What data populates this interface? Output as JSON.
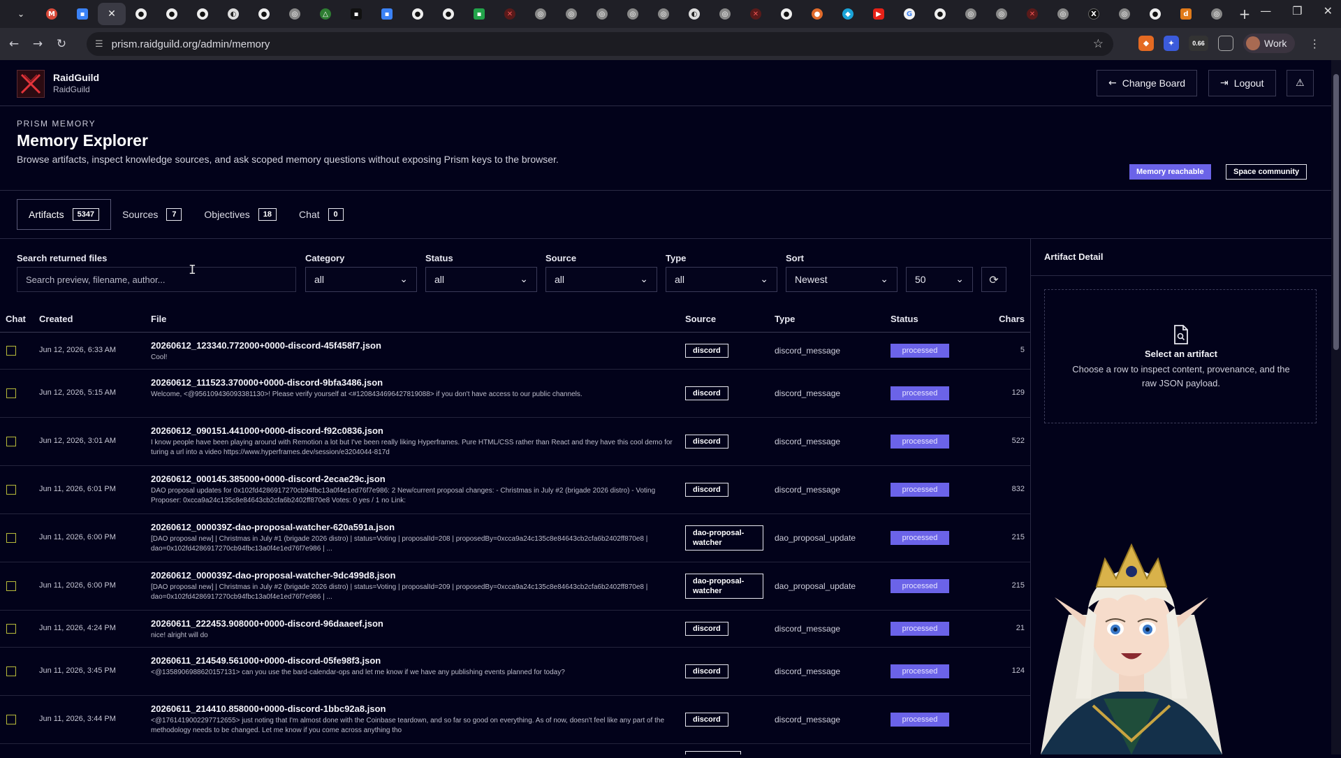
{
  "browser": {
    "url": "prism.raidguild.org/admin/memory",
    "profile_label": "Work",
    "ext_badge": "0.66"
  },
  "header": {
    "org_name": "RaidGuild",
    "org_sub": "RaidGuild",
    "change_board_label": "Change Board",
    "logout_label": "Logout"
  },
  "page": {
    "eyebrow": "PRISM MEMORY",
    "title": "Memory Explorer",
    "description": "Browse artifacts, inspect knowledge sources, and ask scoped memory questions without exposing Prism keys to the browser.",
    "badge_memory": "Memory reachable",
    "badge_space": "Space community"
  },
  "tabs": [
    {
      "label": "Artifacts",
      "count": "5347"
    },
    {
      "label": "Sources",
      "count": "7"
    },
    {
      "label": "Objectives",
      "count": "18"
    },
    {
      "label": "Chat",
      "count": "0"
    }
  ],
  "filters": {
    "search_label": "Search returned files",
    "search_placeholder": "Search preview, filename, author...",
    "category_label": "Category",
    "category_value": "all",
    "status_label": "Status",
    "status_value": "all",
    "source_label": "Source",
    "source_value": "all",
    "type_label": "Type",
    "type_value": "all",
    "sort_label": "Sort",
    "sort_value": "Newest",
    "limit_value": "50"
  },
  "table": {
    "columns": [
      "Chat",
      "Created",
      "File",
      "Source",
      "Type",
      "Status",
      "Chars"
    ],
    "rows": [
      {
        "created": "Jun 12, 2026, 6:33 AM",
        "file": "20260612_123340.772000+0000-discord-45f458f7.json",
        "preview": "Cool!",
        "source": "discord",
        "type": "discord_message",
        "status": "processed",
        "chars": "5"
      },
      {
        "created": "Jun 12, 2026, 5:15 AM",
        "file": "20260612_111523.370000+0000-discord-9bfa3486.json",
        "preview": "Welcome, <@956109436093381130>! Please verify yourself at <#1208434696427819088> if you don't have access to our public channels.",
        "source": "discord",
        "type": "discord_message",
        "status": "processed",
        "chars": "129"
      },
      {
        "created": "Jun 12, 2026, 3:01 AM",
        "file": "20260612_090151.441000+0000-discord-f92c0836.json",
        "preview": "I know people have been playing around with Remotion a lot but I've been really liking Hyperframes. Pure HTML/CSS rather than React and they have this cool demo for turing a url into a video https://www.hyperframes.dev/session/e3204044-817d",
        "source": "discord",
        "type": "discord_message",
        "status": "processed",
        "chars": "522"
      },
      {
        "created": "Jun 11, 2026, 6:01 PM",
        "file": "20260612_000145.385000+0000-discord-2ecae29c.json",
        "preview": "DAO proposal updates for 0x102fd4286917270cb94fbc13a0f4e1ed76f7e986: 2 New/current proposal changes: - Christmas in July #2 (brigade 2026 distro) - Voting Proposer: 0xcca9a24c135c8e84643cb2cfa6b2402ff870e8 Votes: 0 yes / 1 no Link:",
        "source": "discord",
        "type": "discord_message",
        "status": "processed",
        "chars": "832"
      },
      {
        "created": "Jun 11, 2026, 6:00 PM",
        "file": "20260612_000039Z-dao-proposal-watcher-620a591a.json",
        "preview": "[DAO proposal new] | Christmas in July #1 (brigade 2026 distro) | status=Voting | proposalId=208 | proposedBy=0xcca9a24c135c8e84643cb2cfa6b2402ff870e8 | dao=0x102fd4286917270cb94fbc13a0f4e1ed76f7e986 | ...",
        "source": "dao-proposal-watcher",
        "type": "dao_proposal_update",
        "status": "processed",
        "chars": "215"
      },
      {
        "created": "Jun 11, 2026, 6:00 PM",
        "file": "20260612_000039Z-dao-proposal-watcher-9dc499d8.json",
        "preview": "[DAO proposal new] | Christmas in July #2 (brigade 2026 distro) | status=Voting | proposalId=209 | proposedBy=0xcca9a24c135c8e84643cb2cfa6b2402ff870e8 | dao=0x102fd4286917270cb94fbc13a0f4e1ed76f7e986 | ...",
        "source": "dao-proposal-watcher",
        "type": "dao_proposal_update",
        "status": "processed",
        "chars": "215"
      },
      {
        "created": "Jun 11, 2026, 4:24 PM",
        "file": "20260611_222453.908000+0000-discord-96daaeef.json",
        "preview": "nice! alright will do",
        "source": "discord",
        "type": "discord_message",
        "status": "processed",
        "chars": "21"
      },
      {
        "created": "Jun 11, 2026, 3:45 PM",
        "file": "20260611_214549.561000+0000-discord-05fe98f3.json",
        "preview": "<@1358906988620157131> can you use the bard-calendar-ops and let me know if we have any publishing events planned for today?",
        "source": "discord",
        "type": "discord_message",
        "status": "processed",
        "chars": "124"
      },
      {
        "created": "Jun 11, 2026, 3:44 PM",
        "file": "20260611_214410.858000+0000-discord-1bbc92a8.json",
        "preview": "<@1761419002297712655> just noting that I'm almost done with the Coinbase teardown, and so far so good on everything. As of now, doesn't feel like any part of the methodology needs to be changed. Let me know if you come across anything tho",
        "source": "discord",
        "type": "discord_message",
        "status": "processed",
        "chars": ""
      }
    ]
  },
  "detail": {
    "title": "Artifact Detail",
    "empty_head": "Select an artifact",
    "empty_msg": "Choose a row to inspect content, provenance, and the raw JSON payload."
  }
}
